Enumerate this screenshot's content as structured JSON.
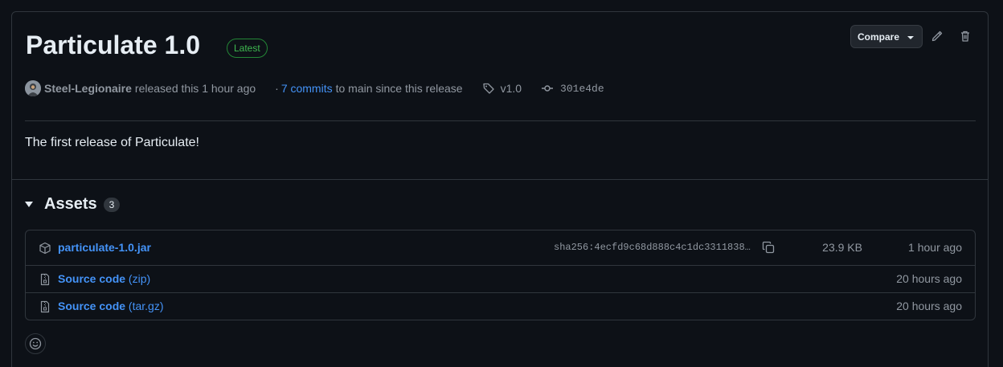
{
  "release": {
    "title": "Particulate 1.0",
    "badge": "Latest",
    "author": "Steel-Legionaire",
    "released_text": "released this 1 hour ago",
    "commits_prefix": "·",
    "commits_link": "7 commits",
    "commits_suffix": "to main since this release",
    "tag": "v1.0",
    "commit_hash": "301e4de",
    "description": "The first release of Particulate!"
  },
  "toolbar": {
    "compare_label": "Compare"
  },
  "assets": {
    "title": "Assets",
    "count": "3",
    "items": [
      {
        "name": "particulate-1.0.jar",
        "suffix": "",
        "sha": "sha256:4ecfd9c68d888c4c1dc3311838…",
        "size": "23.9 KB",
        "time": "1 hour ago",
        "icon": "package-icon"
      },
      {
        "name": "Source code",
        "suffix": "(zip)",
        "sha": "",
        "size": "",
        "time": "20 hours ago",
        "icon": "file-zip-icon"
      },
      {
        "name": "Source code",
        "suffix": "(tar.gz)",
        "sha": "",
        "size": "",
        "time": "20 hours ago",
        "icon": "file-zip-icon"
      }
    ]
  },
  "colors": {
    "background": "#0d1117",
    "border": "#30363d",
    "link": "#4493f8",
    "latest_badge": "#3fb950",
    "muted_text": "#9198a1"
  }
}
